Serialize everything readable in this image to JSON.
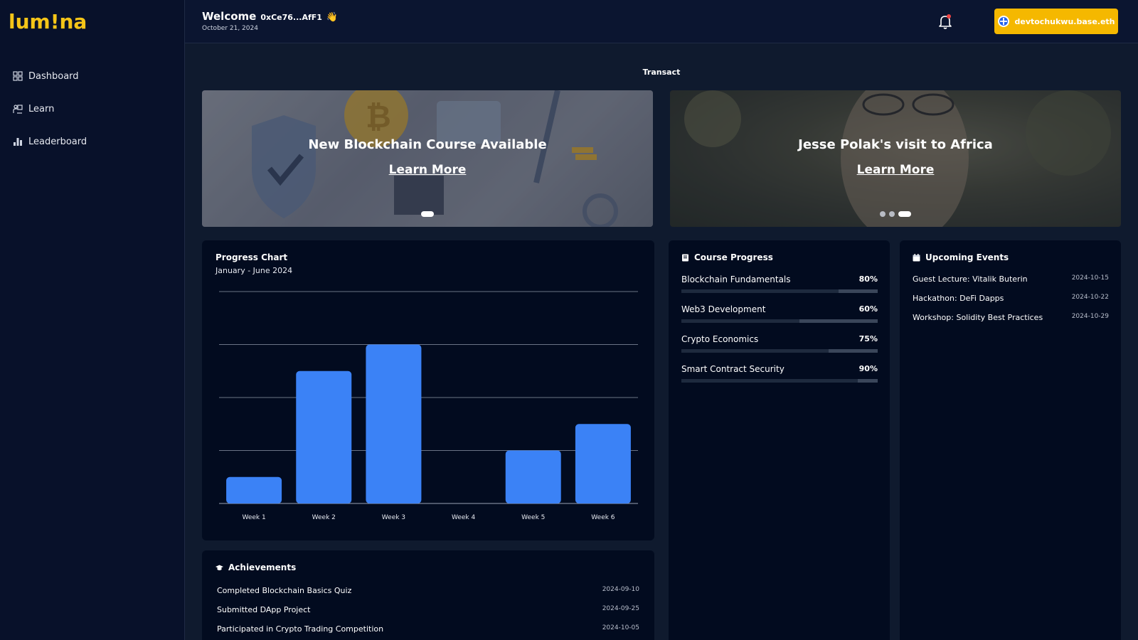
{
  "brand": {
    "logo_text": "lum!na",
    "accent": "#f5c518"
  },
  "sidebar": {
    "items": [
      {
        "label": "Dashboard",
        "icon": "grid-icon"
      },
      {
        "label": "Learn",
        "icon": "learn-icon"
      },
      {
        "label": "Leaderboard",
        "icon": "bar-chart-icon"
      }
    ]
  },
  "header": {
    "welcome": "Welcome",
    "address": "0xCe76...AfF1",
    "wave": "👋",
    "date": "October 21, 2024",
    "wallet_label": "devtochukwu.base.eth",
    "wallet_color": "#f5b800"
  },
  "transact_label": "Transact",
  "banners": [
    {
      "title": "New Blockchain Course Available",
      "link": "Learn More"
    },
    {
      "title": "Jesse Polak's visit to Africa",
      "link": "Learn More"
    }
  ],
  "progress_chart": {
    "title": "Progress Chart",
    "subtitle": "January - June 2024"
  },
  "chart_data": {
    "type": "bar",
    "categories": [
      "Week 1",
      "Week 2",
      "Week 3",
      "Week 4",
      "Week 5",
      "Week 6"
    ],
    "values": [
      10,
      50,
      60,
      0,
      20,
      30
    ],
    "title": "Progress Chart",
    "subtitle": "January - June 2024",
    "xlabel": "",
    "ylabel": "",
    "ylim": [
      0,
      80
    ],
    "grid": true,
    "bar_color": "#3b82f6"
  },
  "course_progress": {
    "title": "Course Progress",
    "items": [
      {
        "name": "Blockchain Fundamentals",
        "percent_label": "80%",
        "value": 80
      },
      {
        "name": "Web3 Development",
        "percent_label": "60%",
        "value": 60
      },
      {
        "name": "Crypto Economics",
        "percent_label": "75%",
        "value": 75
      },
      {
        "name": "Smart Contract Security",
        "percent_label": "90%",
        "value": 90
      }
    ]
  },
  "upcoming_events": {
    "title": "Upcoming Events",
    "items": [
      {
        "name": "Guest Lecture: Vitalik Buterin",
        "date": "2024-10-15"
      },
      {
        "name": "Hackathon: DeFi Dapps",
        "date": "2024-10-22"
      },
      {
        "name": "Workshop: Solidity Best Practices",
        "date": "2024-10-29"
      }
    ]
  },
  "achievements": {
    "title": "Achievements",
    "items": [
      {
        "name": "Completed Blockchain Basics Quiz",
        "date": "2024-09-10"
      },
      {
        "name": "Submitted DApp Project",
        "date": "2024-09-25"
      },
      {
        "name": "Participated in Crypto Trading Competition",
        "date": "2024-10-05"
      }
    ]
  }
}
